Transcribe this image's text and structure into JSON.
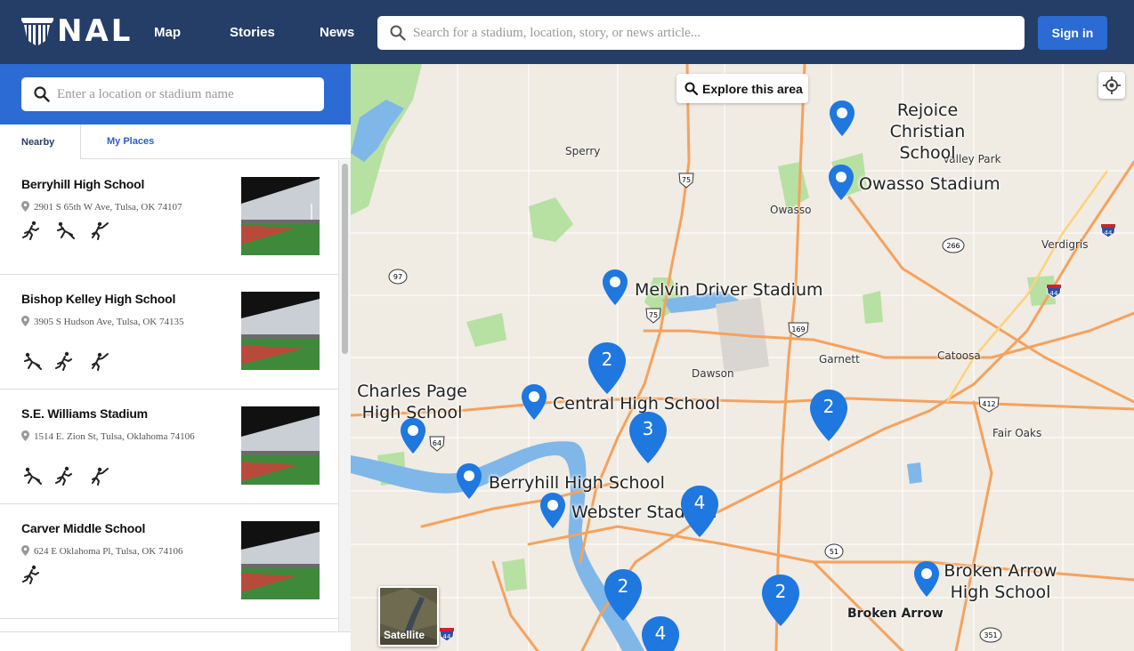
{
  "brand": {
    "logo_text": "NAL"
  },
  "nav": {
    "map": "Map",
    "stories": "Stories",
    "news": "News"
  },
  "search": {
    "placeholder": "Search for a stadium, location, story, or news article..."
  },
  "auth": {
    "sign_in": "Sign in"
  },
  "sidebar": {
    "search_placeholder": "Enter a location or stadium name",
    "tabs": {
      "nearby": "Nearby",
      "my_places": "My Places"
    },
    "items": [
      {
        "name": "Berryhill High School",
        "address": "2901 S 65th W Ave, Tulsa, OK 74107",
        "sports": [
          "running",
          "sliding",
          "throwing"
        ]
      },
      {
        "name": "Bishop Kelley High School",
        "address": "3905 S Hudson Ave, Tulsa, OK 74135",
        "sports": [
          "sliding",
          "running",
          "throwing"
        ]
      },
      {
        "name": "S.E. Williams Stadium",
        "address": "1514 E. Zion St, Tulsa, Oklahoma 74106",
        "sports": [
          "sliding",
          "running",
          "throwing"
        ]
      },
      {
        "name": "Carver Middle School",
        "address": "624 E Oklahoma Pl, Tulsa, OK 74106",
        "sports": [
          "running"
        ]
      }
    ]
  },
  "map": {
    "explore_button": "Explore this area",
    "satellite_label": "Satellite",
    "stadium_labels": {
      "rejoice": "Rejoice Christian School",
      "owasso": "Owasso Stadium",
      "melvin": "Melvin Driver Stadium",
      "charles": "Charles Page High School",
      "central": "Central High School",
      "berryhill": "Berryhill High School",
      "webster": "Webster Stadium",
      "broken_arrow_hs": "Broken Arrow High School"
    },
    "places": {
      "sperry": "Sperry",
      "valley_park": "Valley Park",
      "owasso": "Owasso",
      "verdigris": "Verdigris",
      "dawson": "Dawson",
      "garnett": "Garnett",
      "catoosa": "Catoosa",
      "fair_oaks": "Fair Oaks",
      "broken_arrow": "Broken Arrow"
    },
    "shields": {
      "us75_north": "75",
      "i44_east": "44",
      "sh266": "266",
      "sh97": "97",
      "us75_mid": "75",
      "i44_mid": "44",
      "us169": "169",
      "us64": "64",
      "us412": "412",
      "sh51": "51",
      "i44_south": "44",
      "sh351": "351"
    },
    "clusters": {
      "c1": "2",
      "c2": "3",
      "c3": "2",
      "c4": "4",
      "c5": "2",
      "c6": "2",
      "c7": "4"
    },
    "colors": {
      "marker": "#1f77e0",
      "road": "#f5a25d",
      "water": "#7fb7e8",
      "park": "#b7e0a3",
      "land": "#f0ebe3"
    }
  }
}
